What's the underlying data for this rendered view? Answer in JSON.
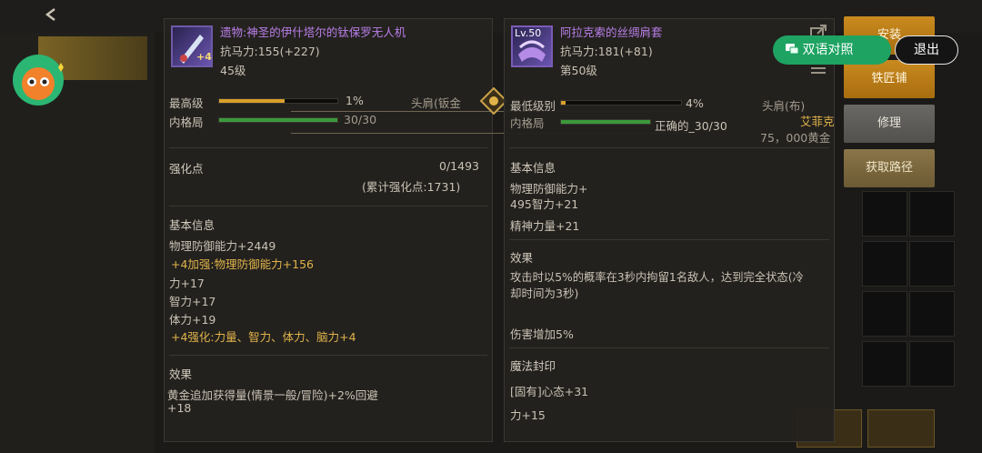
{
  "left_item": {
    "name": "遗物:神圣的伊什塔尔的钛保罗无人机",
    "level_badge": "+4",
    "resistance": "抗马力:155(+227)",
    "level": "45级",
    "highest_label": "最高级",
    "highest_percent": "1%",
    "highest_fill": 0.55,
    "inner_label": "内格局",
    "inner_value": "30/30",
    "inner_fill": 1.0,
    "slot": "头肩(钣金",
    "enhance_label": "强化点",
    "enhance_value": "0/1493",
    "enhance_total": "(累计强化点:1731)",
    "basic_title": "基本信息",
    "basic_lines": [
      {
        "text": "物理防御能力+2449",
        "gold": false
      },
      {
        "text": "+4加强:物理防御能力+156",
        "gold": true
      },
      {
        "text": "力+17",
        "gold": false
      },
      {
        "text": "智力+17",
        "gold": false
      },
      {
        "text": "体力+19",
        "gold": false
      },
      {
        "text": "+4强化:力量、智力、体力、脑力+4",
        "gold": true
      }
    ],
    "effect_title": "效果",
    "effect_text_1": "黄金追加获得量(情景一般/冒险)+2%回避",
    "effect_text_2": "+18"
  },
  "right_item": {
    "name": "阿拉克索的丝绸肩套",
    "icon_level": "Lv.50",
    "resistance": "抗马力:181(+81)",
    "level": "第50级",
    "lowest_label": "最低级别",
    "lowest_percent": "4%",
    "lowest_fill": 0.04,
    "inner_label": "内格局",
    "inner_value_prefix": "正确的_30/30",
    "inner_fill": 1.0,
    "slot": "头肩(布)",
    "seller": "艾菲克",
    "price": "75，000黄金",
    "basic_title": "基本信息",
    "basic_lines": [
      "物理防御能力+",
      "495智力+21",
      "精神力量+21"
    ],
    "effect_title": "效果",
    "effect_text_1": "攻击时以5%的概率在3秒内拘留1名敌人，达到完全状态(冷",
    "effect_text_2": "却时间为3秒)",
    "damage_text": "伤害增加5%",
    "seal_title": "魔法封印",
    "seal_lines": [
      "[固有]心态+31",
      "力+15"
    ]
  },
  "buttons": {
    "install": "安装",
    "blacksmith": "铁匠铺",
    "repair": "修理",
    "obtain": "获取路径",
    "bilingual": "双语对照",
    "exit": "退出"
  },
  "colors": {
    "gold": "#e0b34a",
    "purple": "#b87ee8",
    "green_pill": "#1ea362",
    "bar_gold": "#d9a02c",
    "bar_green": "#3b9a3a"
  }
}
